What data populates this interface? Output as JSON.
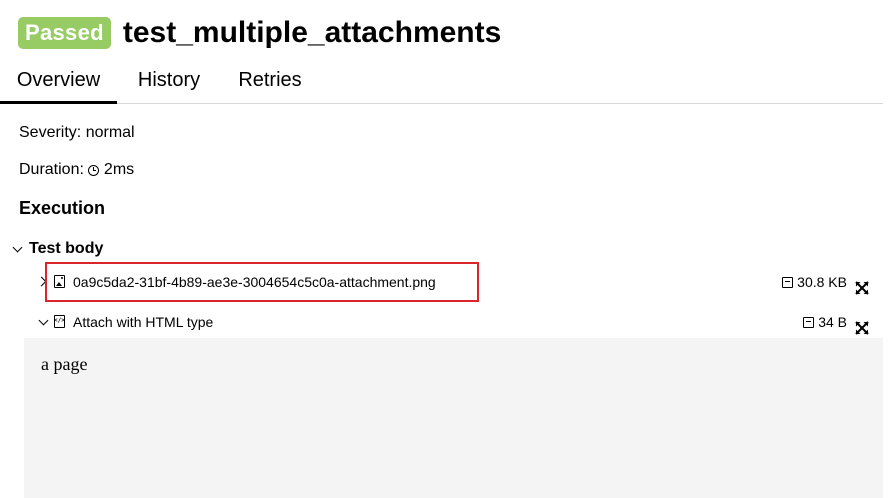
{
  "header": {
    "status_badge": "Passed",
    "status_color": "#97cc64",
    "test_name": "test_multiple_attachments"
  },
  "tabs": [
    {
      "label": "Overview",
      "active": true
    },
    {
      "label": "History",
      "active": false
    },
    {
      "label": "Retries",
      "active": false
    }
  ],
  "overview": {
    "severity_label": "Severity:",
    "severity_value": "normal",
    "duration_label": "Duration:",
    "duration_icon": "clock-icon",
    "duration_value": "2ms"
  },
  "execution": {
    "title": "Execution",
    "test_body": {
      "label": "Test body",
      "expanded": true,
      "attachments": [
        {
          "name": "0a9c5da2-31bf-4b89-ae3e-3004654c5c0a-attachment.png",
          "icon": "image-file-icon",
          "size": "30.8 KB",
          "expanded": false,
          "highlighted": true,
          "highlight_color": "#d9252b"
        },
        {
          "name": "Attach with HTML type",
          "icon": "code-file-icon",
          "size": "34 B",
          "expanded": true,
          "preview_text": "a page"
        }
      ]
    }
  }
}
